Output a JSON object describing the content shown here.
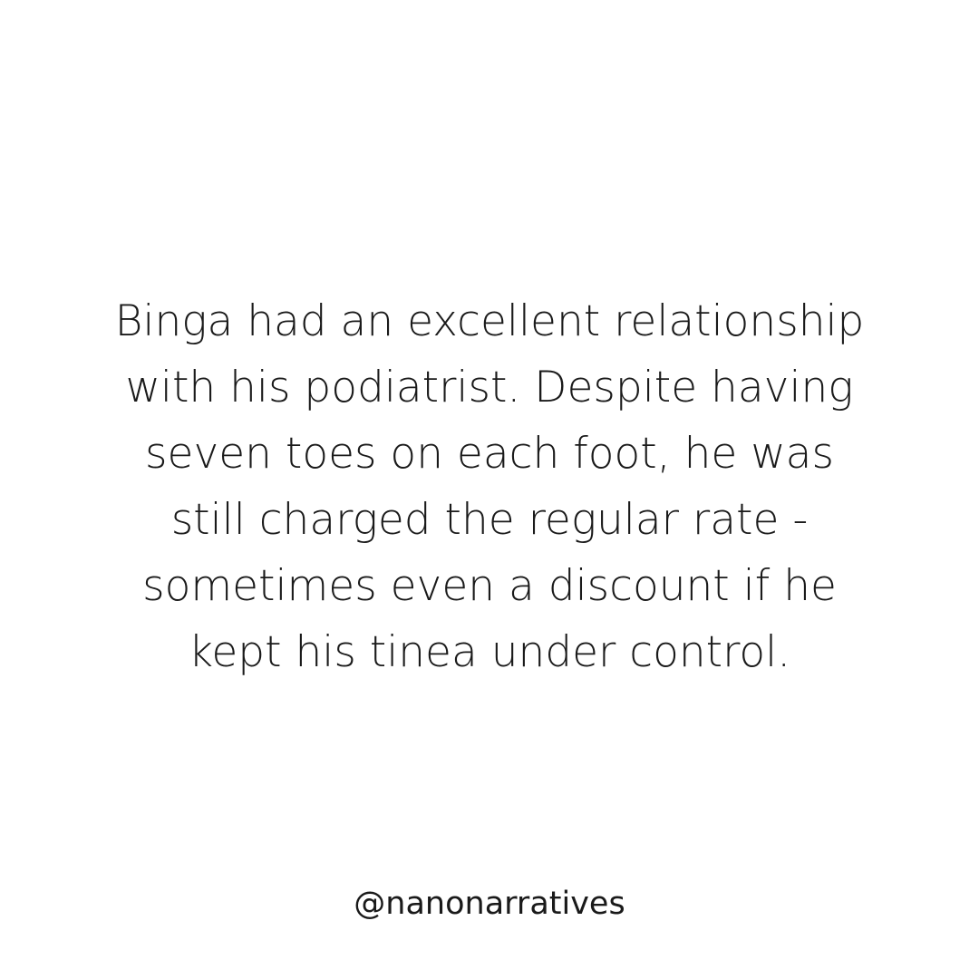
{
  "post": {
    "background_color": "#ffffff",
    "text_color": "#1a1a1a",
    "story_lines": [
      "Binga had an excellent relationship",
      "with his podiatrist. Despite having",
      "seven toes on each foot, he was",
      "still charged the regular rate -",
      "sometimes even a discount if he",
      "kept his tinea under control."
    ],
    "handle": "@nanonarratives"
  }
}
